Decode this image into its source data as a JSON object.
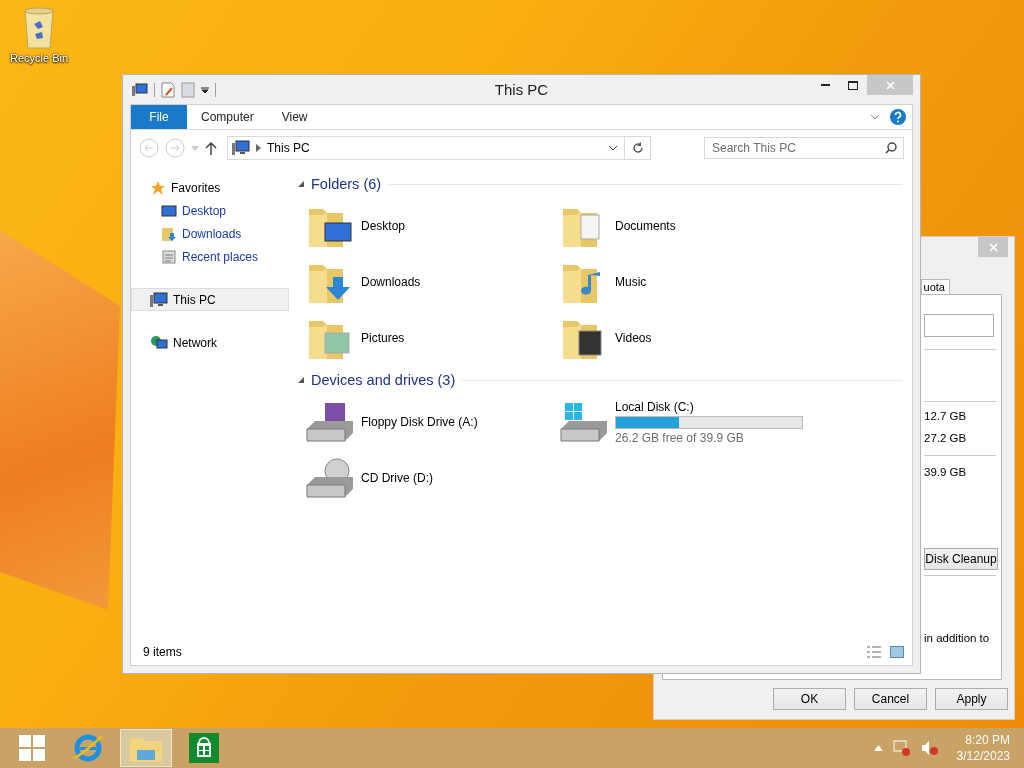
{
  "desktop": {
    "icons": [
      {
        "label": "Recycle Bin"
      }
    ]
  },
  "background_dialog": {
    "tab": "uota",
    "sizes": [
      "12.7 GB",
      "27.2 GB",
      "39.9 GB"
    ],
    "cleanup_button": "Disk Cleanup",
    "note": "in addition to",
    "buttons": [
      "OK",
      "Cancel",
      "Apply"
    ]
  },
  "explorer": {
    "title": "This PC",
    "ribbon_tabs": [
      {
        "label": "File",
        "selected": true
      },
      {
        "label": "Computer",
        "selected": false
      },
      {
        "label": "View",
        "selected": false
      }
    ],
    "address": "This PC",
    "search": {
      "placeholder": "Search This PC"
    },
    "navigation": [
      {
        "label": "Favorites",
        "kind": "favorites",
        "selected": false,
        "children": [
          {
            "label": "Desktop",
            "kind": "desktop"
          },
          {
            "label": "Downloads",
            "kind": "downloads"
          },
          {
            "label": "Recent places",
            "kind": "recent"
          }
        ]
      },
      {
        "label": "This PC",
        "kind": "pc",
        "selected": true
      },
      {
        "label": "Network",
        "kind": "network",
        "selected": false
      }
    ],
    "sections": [
      {
        "title": "Folders (6)",
        "expanded": true,
        "items": [
          {
            "label": "Desktop",
            "kind": "desktop"
          },
          {
            "label": "Documents",
            "kind": "documents"
          },
          {
            "label": "Downloads",
            "kind": "downloads"
          },
          {
            "label": "Music",
            "kind": "music"
          },
          {
            "label": "Pictures",
            "kind": "pictures"
          },
          {
            "label": "Videos",
            "kind": "videos"
          }
        ]
      },
      {
        "title": "Devices and drives (3)",
        "expanded": true,
        "items": [
          {
            "label": "Floppy Disk Drive (A:)",
            "kind": "floppy"
          },
          {
            "label": "Local Disk (C:)",
            "kind": "disk",
            "level": 0.34,
            "detail": "26.2 GB free of 39.9 GB"
          },
          {
            "label": "CD Drive (D:)",
            "kind": "cd"
          }
        ]
      }
    ],
    "status": "9 items"
  },
  "taskbar": {
    "apps": [
      {
        "kind": "browser",
        "selected": false
      },
      {
        "kind": "explorer",
        "selected": true
      },
      {
        "kind": "store",
        "selected": false
      }
    ],
    "time": "8:20 PM",
    "date": "3/12/2023"
  }
}
